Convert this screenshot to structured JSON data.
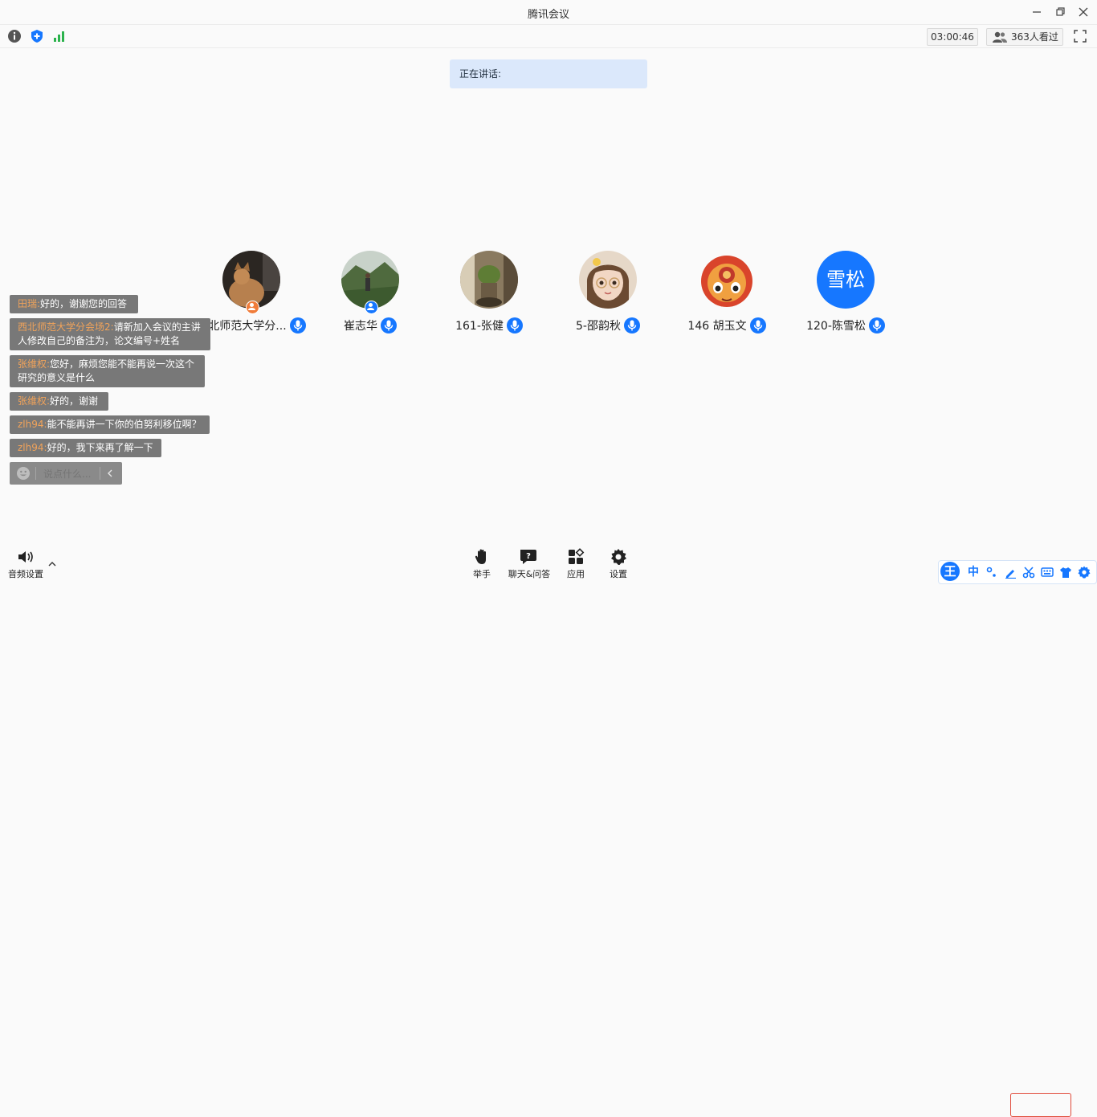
{
  "window": {
    "title": "腾讯会议"
  },
  "toolbar": {
    "timer": "03:00:46",
    "viewers": "363人看过"
  },
  "speaking": {
    "label": "正在讲话:"
  },
  "participants": [
    {
      "name": "西北师范大学分...",
      "role": "host"
    },
    {
      "name": "崔志华",
      "role": "cohost"
    },
    {
      "name": "161-张健"
    },
    {
      "name": "5-邵韵秋"
    },
    {
      "name": "146 胡玉文"
    },
    {
      "name": "120-陈雪松",
      "avatar_text": "雪松"
    }
  ],
  "chat": [
    {
      "sender": "田瑞:",
      "text": "好的，谢谢您的回答"
    },
    {
      "sender": "西北师范大学分会场2:",
      "text": "请新加入会议的主讲人修改自己的备注为，论文编号+姓名"
    },
    {
      "sender": "张维权:",
      "text": "您好，麻烦您能不能再说一次这个研究的意义是什么"
    },
    {
      "sender": "张维权:",
      "text": "好的，谢谢"
    },
    {
      "sender": "zlh94:",
      "text": "能不能再讲一下你的伯努利移位啊？"
    },
    {
      "sender": "zlh94:",
      "text": "好的，我下来再了解一下"
    }
  ],
  "chat_input": {
    "placeholder": "说点什么..."
  },
  "bottom": {
    "audio": "音频设置",
    "raise_hand": "举手",
    "chat_qa": "聊天&问答",
    "apps": "应用",
    "settings": "设置"
  },
  "ime": {
    "logo": "王",
    "mode": "中"
  },
  "colors": {
    "accent": "#1677ff",
    "speaking_bg": "#dbe8fb",
    "chat_bubble": "#787878",
    "sender": "#f1a35a",
    "end": "#e04a3a"
  }
}
